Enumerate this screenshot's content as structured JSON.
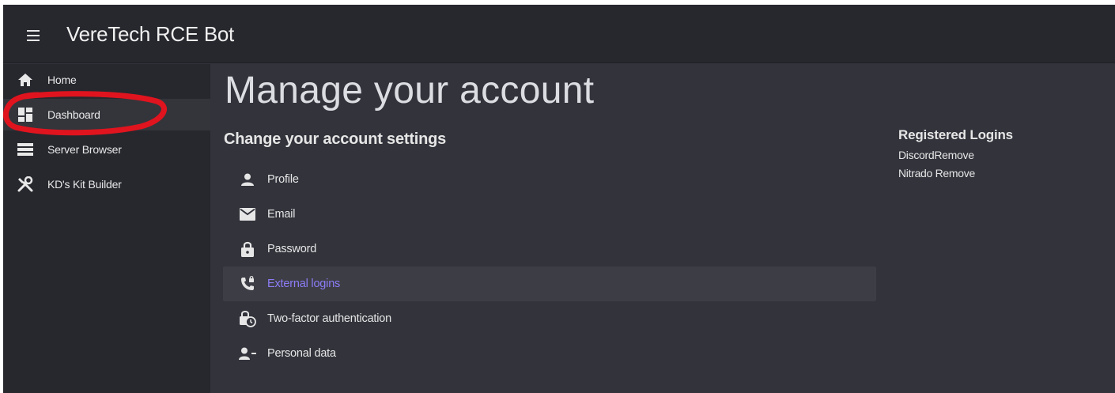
{
  "appbar": {
    "title": "VereTech RCE Bot",
    "menu_icon": "hamburger-icon"
  },
  "sidebar": {
    "items": [
      {
        "label": "Home",
        "icon": "home-icon"
      },
      {
        "label": "Dashboard",
        "icon": "dashboard-icon",
        "active": true
      },
      {
        "label": "Server Browser",
        "icon": "list-icon"
      },
      {
        "label": "KD's Kit Builder",
        "icon": "tools-icon"
      }
    ]
  },
  "main": {
    "page_title": "Manage your account",
    "section_title": "Change your account settings",
    "menu": [
      {
        "label": "Profile",
        "icon": "person-icon"
      },
      {
        "label": "Email",
        "icon": "mail-icon"
      },
      {
        "label": "Password",
        "icon": "lock-icon"
      },
      {
        "label": "External logins",
        "icon": "phone-lock-icon",
        "active": true
      },
      {
        "label": "Two-factor authentication",
        "icon": "lock-clock-icon"
      },
      {
        "label": "Personal data",
        "icon": "person-remove-icon"
      }
    ]
  },
  "registered_logins": {
    "title": "Registered Logins",
    "rows": [
      {
        "provider": "Discord",
        "action": "Remove"
      },
      {
        "provider": "Nitrado",
        "action": "Remove"
      }
    ]
  },
  "colors": {
    "background": "#32333b",
    "sidebar": "#27282e",
    "accent": "#8b7cf6",
    "annotation": "#e0141e"
  }
}
